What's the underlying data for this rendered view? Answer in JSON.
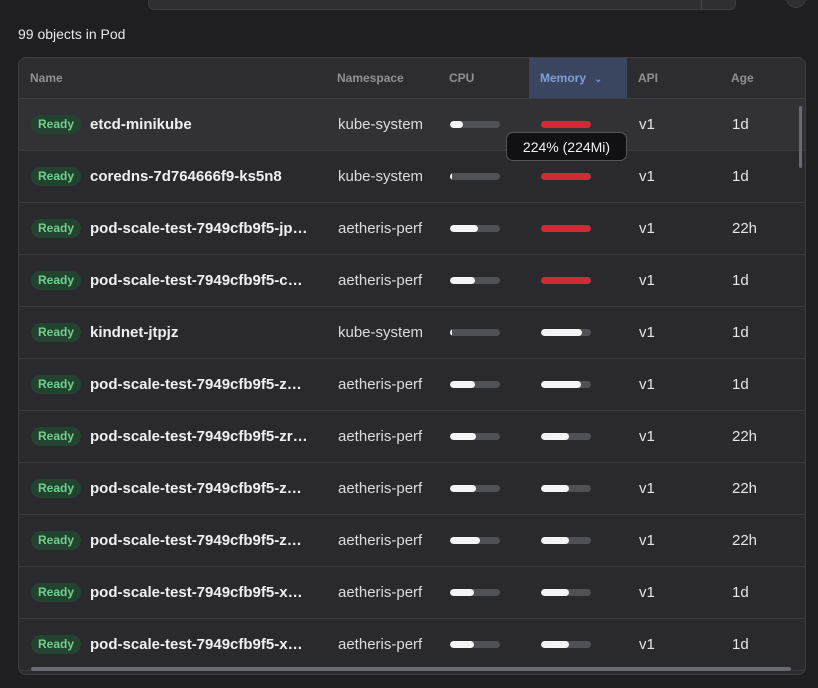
{
  "summary": {
    "count_text": "99 objects in Pod"
  },
  "columns": [
    {
      "key": "name",
      "label": "Name",
      "sorted": false
    },
    {
      "key": "namespace",
      "label": "Namespace",
      "sorted": false
    },
    {
      "key": "cpu",
      "label": "CPU",
      "sorted": false
    },
    {
      "key": "memory",
      "label": "Memory",
      "sorted": true,
      "sort_icon": "chevron-down-icon"
    },
    {
      "key": "api",
      "label": "API",
      "sorted": false
    },
    {
      "key": "age",
      "label": "Age",
      "sorted": false
    }
  ],
  "colors": {
    "cpu_fill": "#f4f4f6",
    "memory_normal": "#f4f4f6",
    "memory_over": "#cf2a35",
    "ready_text": "#6fcf8e",
    "ready_bg": "#23432f"
  },
  "rows": [
    {
      "status": "Ready",
      "name": "etcd-minikube",
      "namespace": "kube-system",
      "cpu": 0.25,
      "memory": 1.0,
      "memory_over": true,
      "api": "v1",
      "age": "1d"
    },
    {
      "status": "Ready",
      "name": "coredns-7d764666f9-ks5n8",
      "namespace": "kube-system",
      "cpu": 0.04,
      "memory": 1.0,
      "memory_over": true,
      "api": "v1",
      "age": "1d"
    },
    {
      "status": "Ready",
      "name": "pod-scale-test-7949cfb9f5-jp…",
      "namespace": "aetheris-perf",
      "cpu": 0.55,
      "memory": 1.0,
      "memory_over": true,
      "api": "v1",
      "age": "22h"
    },
    {
      "status": "Ready",
      "name": "pod-scale-test-7949cfb9f5-c…",
      "namespace": "aetheris-perf",
      "cpu": 0.5,
      "memory": 1.0,
      "memory_over": true,
      "api": "v1",
      "age": "1d"
    },
    {
      "status": "Ready",
      "name": "kindnet-jtpjz",
      "namespace": "kube-system",
      "cpu": 0.04,
      "memory": 0.82,
      "memory_over": false,
      "api": "v1",
      "age": "1d"
    },
    {
      "status": "Ready",
      "name": "pod-scale-test-7949cfb9f5-z…",
      "namespace": "aetheris-perf",
      "cpu": 0.5,
      "memory": 0.8,
      "memory_over": false,
      "api": "v1",
      "age": "1d"
    },
    {
      "status": "Ready",
      "name": "pod-scale-test-7949cfb9f5-zr…",
      "namespace": "aetheris-perf",
      "cpu": 0.52,
      "memory": 0.55,
      "memory_over": false,
      "api": "v1",
      "age": "22h"
    },
    {
      "status": "Ready",
      "name": "pod-scale-test-7949cfb9f5-z…",
      "namespace": "aetheris-perf",
      "cpu": 0.52,
      "memory": 0.55,
      "memory_over": false,
      "api": "v1",
      "age": "22h"
    },
    {
      "status": "Ready",
      "name": "pod-scale-test-7949cfb9f5-z…",
      "namespace": "aetheris-perf",
      "cpu": 0.6,
      "memory": 0.55,
      "memory_over": false,
      "api": "v1",
      "age": "22h"
    },
    {
      "status": "Ready",
      "name": "pod-scale-test-7949cfb9f5-x…",
      "namespace": "aetheris-perf",
      "cpu": 0.48,
      "memory": 0.55,
      "memory_over": false,
      "api": "v1",
      "age": "1d"
    },
    {
      "status": "Ready",
      "name": "pod-scale-test-7949cfb9f5-x…",
      "namespace": "aetheris-perf",
      "cpu": 0.48,
      "memory": 0.55,
      "memory_over": false,
      "api": "v1",
      "age": "1d"
    }
  ],
  "tooltip": {
    "text": "224% (224Mi)"
  }
}
